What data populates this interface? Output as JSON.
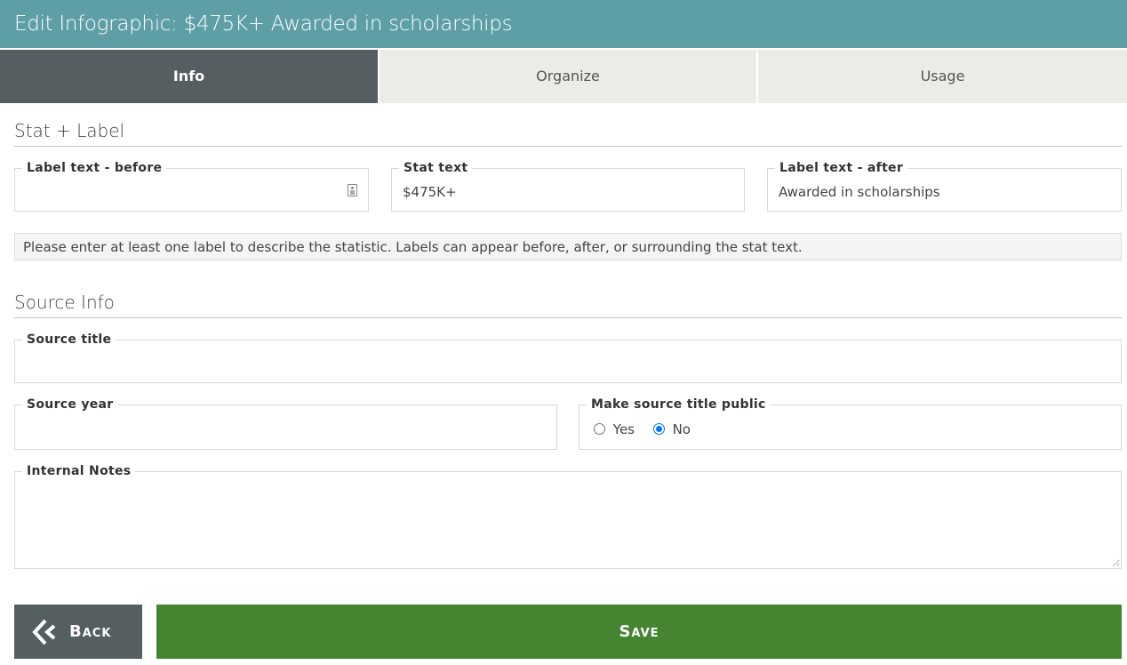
{
  "header": {
    "title": "Edit Infographic: $475K+ Awarded in scholarships"
  },
  "tabs": [
    {
      "label": "Info",
      "active": true
    },
    {
      "label": "Organize",
      "active": false
    },
    {
      "label": "Usage",
      "active": false
    }
  ],
  "stat_section": {
    "title": "Stat + Label",
    "label_before": {
      "label": "Label text - before",
      "value": ""
    },
    "stat_text": {
      "label": "Stat text",
      "value": "$475K+"
    },
    "label_after": {
      "label": "Label text - after",
      "value": "Awarded in scholarships"
    },
    "help_text": "Please enter at least one label to describe the statistic. Labels can appear before, after, or surrounding the stat text."
  },
  "source_section": {
    "title": "Source Info",
    "source_title": {
      "label": "Source title",
      "value": ""
    },
    "source_year": {
      "label": "Source year",
      "value": ""
    },
    "make_public": {
      "label": "Make source title public",
      "options": [
        "Yes",
        "No"
      ],
      "selected": "No"
    },
    "internal_notes": {
      "label": "Internal Notes",
      "value": ""
    }
  },
  "buttons": {
    "back": "Back",
    "save": "Save"
  }
}
